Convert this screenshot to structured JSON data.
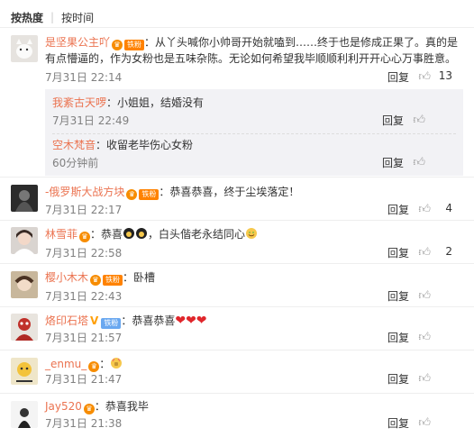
{
  "sort": {
    "hot": "按热度",
    "time": "按时间"
  },
  "comments": [
    {
      "user": "是坚果公主吖",
      "badges": [
        "vip",
        "fan"
      ],
      "fan_label": "铁粉",
      "sep": "：",
      "text": "从丫头喊你小帅哥开始就嗑到……终于也是修成正果了。真的是有点懵逼的，作为女粉也是五味杂陈。无论如何希望我毕顺顺利利开开心心万事胜意。",
      "time": "7月31日 22:14",
      "reply": "回复",
      "likes": "13",
      "subreplies": [
        {
          "user": "我紊古天啰",
          "sep": "：",
          "text": "小姐姐，结婚没有",
          "time": "7月31日 22:49",
          "reply": "回复",
          "likes": ""
        },
        {
          "user": "空木梵音",
          "sep": "：",
          "text": "收留老毕伤心女粉",
          "time": "60分钟前",
          "reply": "回复",
          "likes": ""
        }
      ]
    },
    {
      "user": "-俄罗斯大战方块",
      "fan_label": "铁粉",
      "sep": "：",
      "text": "恭喜恭喜，终于尘埃落定！",
      "time": "7月31日 22:17",
      "reply": "回复",
      "likes": "4"
    },
    {
      "user": "林雪菲",
      "sep": "：",
      "text": "恭喜",
      "text2": "，白头偕老永结同心",
      "time": "7月31日 22:58",
      "reply": "回复",
      "likes": "2"
    },
    {
      "user": "樱小木木",
      "fan_label": "铁粉",
      "sep": "：",
      "text": "卧槽",
      "time": "7月31日 22:43",
      "reply": "回复",
      "likes": ""
    },
    {
      "user": "烙印石塔",
      "iron_label": "铁粉",
      "sep": "：",
      "text": "恭喜恭喜",
      "time": "7月31日 21:57",
      "reply": "回复",
      "likes": ""
    },
    {
      "user": "_enmu_",
      "sep": "：",
      "text": "",
      "time": "7月31日 21:47",
      "reply": "回复",
      "likes": ""
    },
    {
      "user": "Jay520",
      "sep": "：",
      "text": "恭喜我毕",
      "time": "7月31日 21:38",
      "reply": "回复",
      "likes": ""
    }
  ]
}
